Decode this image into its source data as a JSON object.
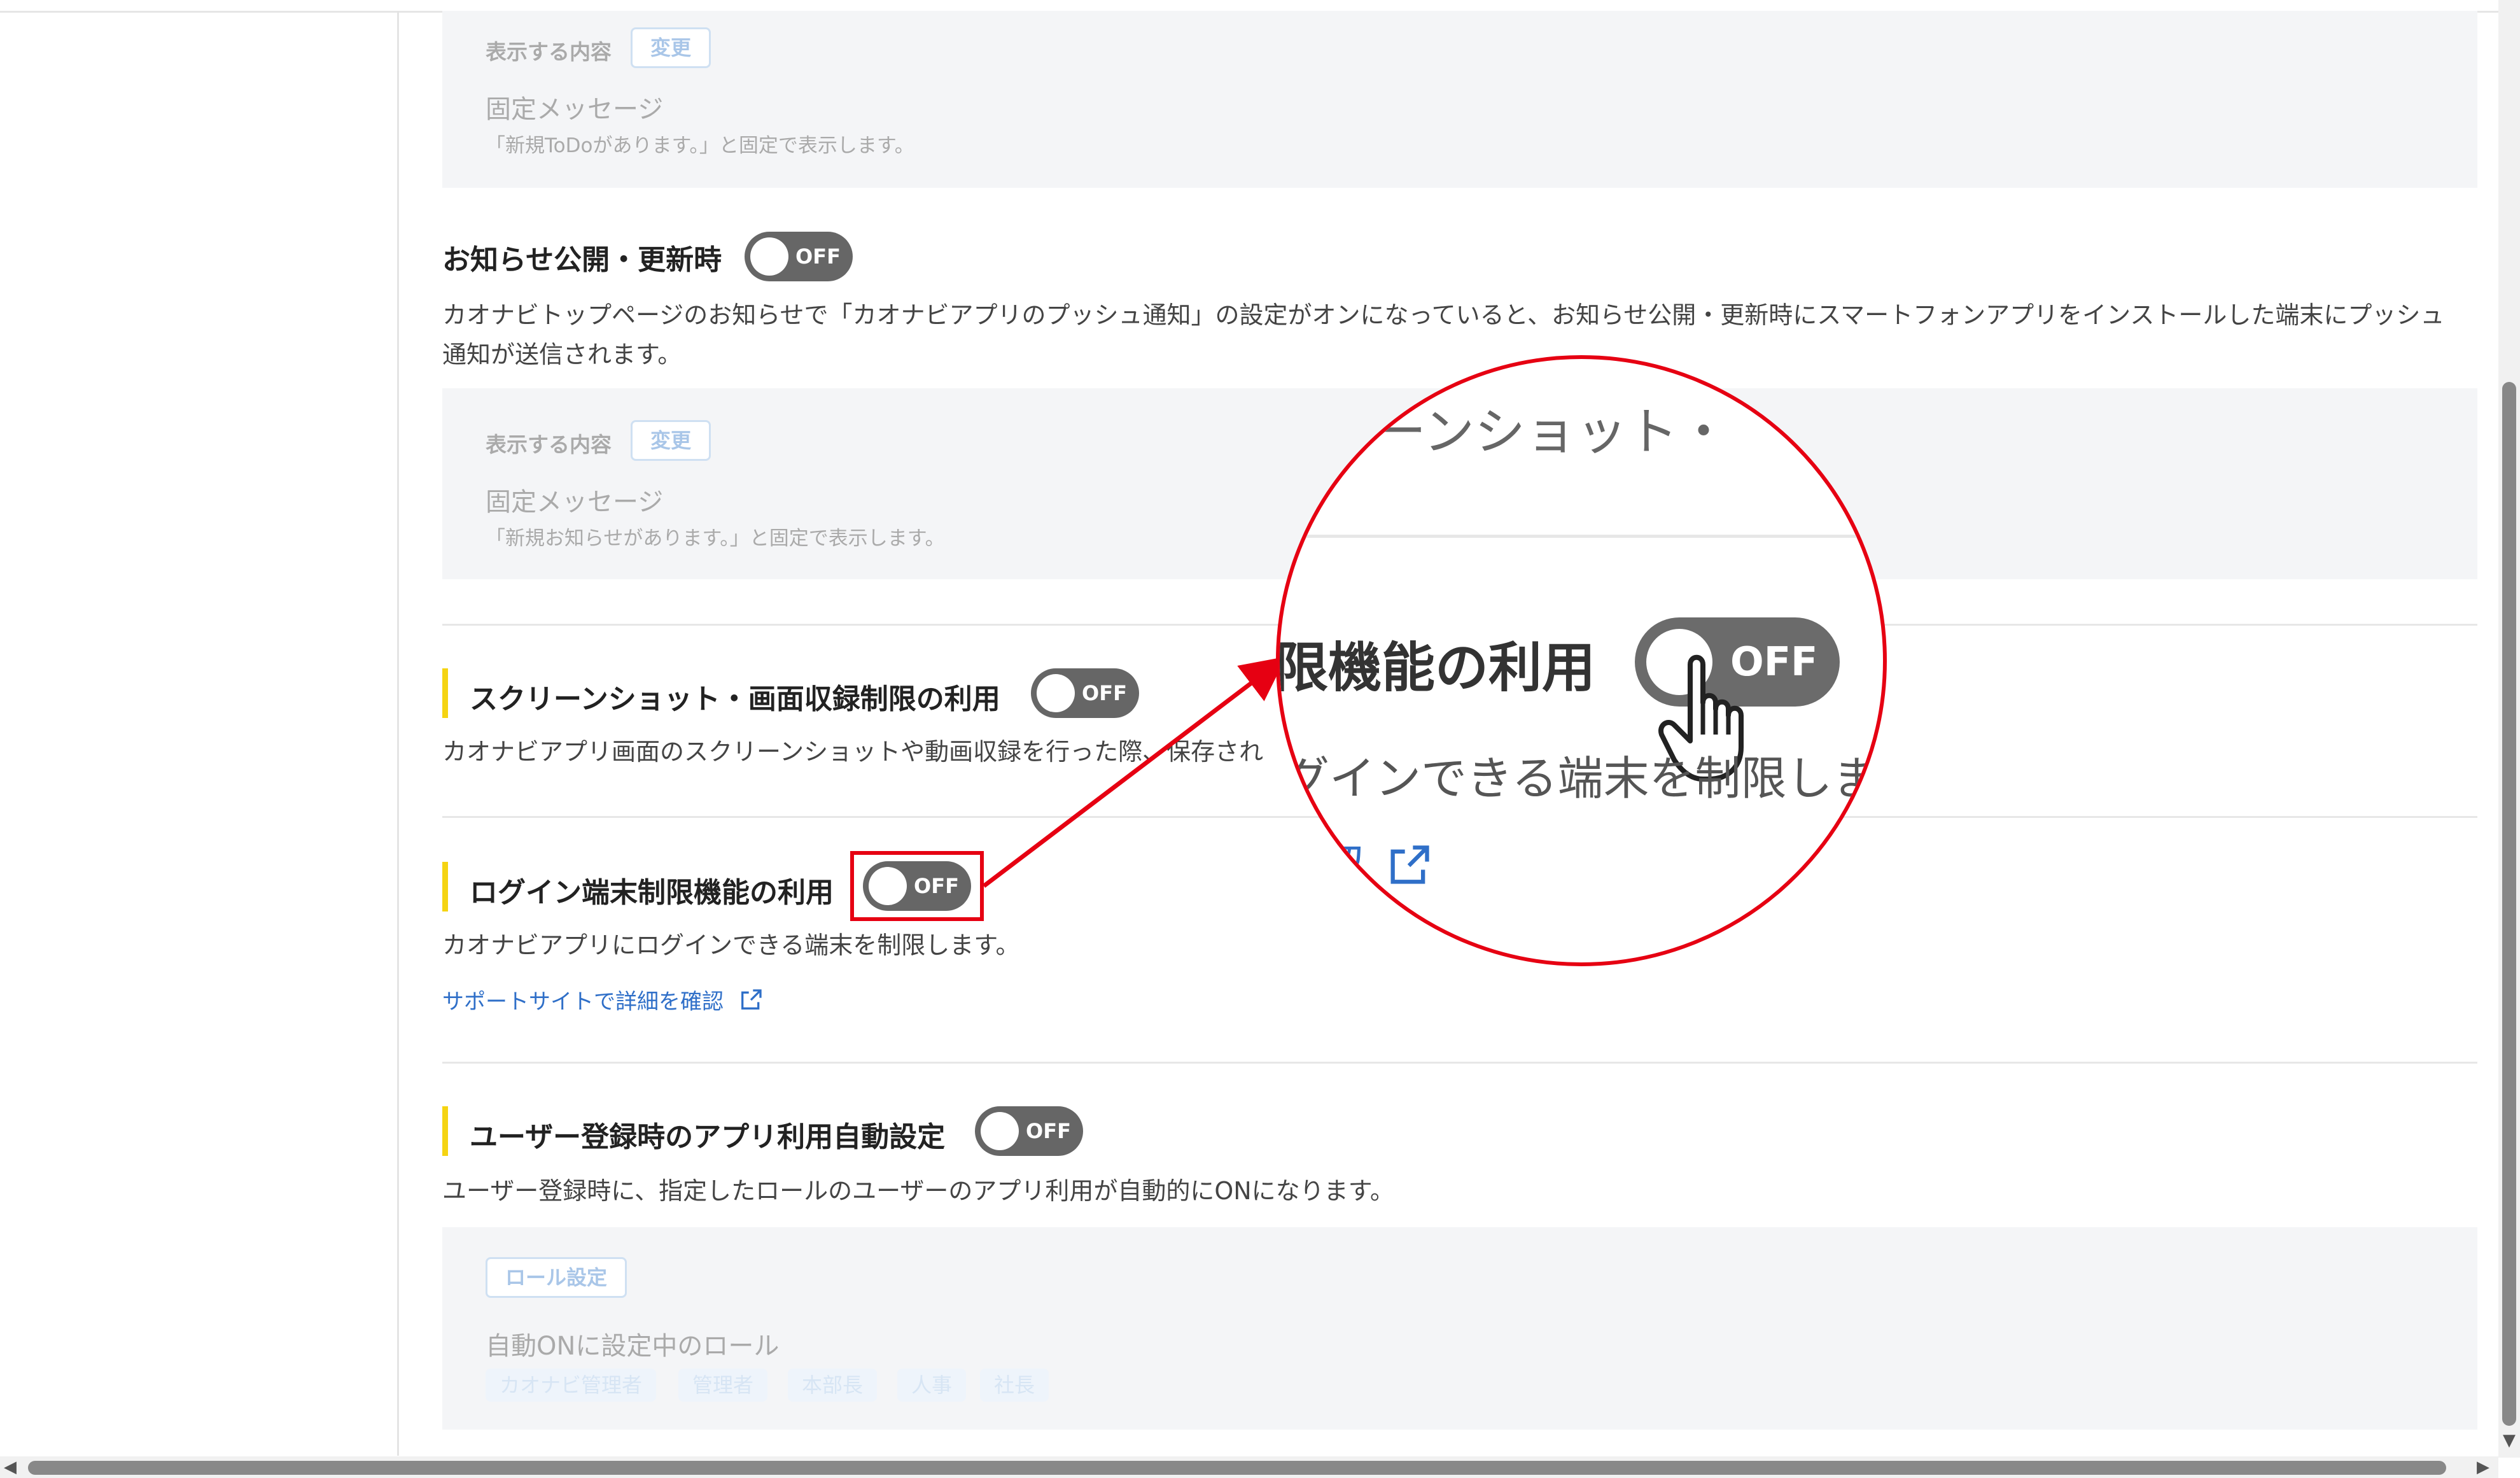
{
  "todo_section": {
    "display_label": "表示する内容",
    "change_button": "変更",
    "message_title": "固定メッセージ",
    "message_sub": "「新規ToDoがあります。」と固定で表示します。"
  },
  "notice_section": {
    "title": "お知らせ公開・更新時",
    "toggle": "OFF",
    "description": "カオナビトップページのお知らせで「カオナビアプリのプッシュ通知」の設定がオンになっていると、お知らせ公開・更新時にスマートフォンアプリをインストールした端末にプッシュ通知が送信されます。",
    "display_label": "表示する内容",
    "change_button": "変更",
    "message_title": "固定メッセージ",
    "message_sub": "「新規お知らせがあります。」と固定で表示します。"
  },
  "screenshot_section": {
    "title": "スクリーンショット・画面収録制限の利用",
    "toggle": "OFF",
    "description": "カオナビアプリ画面のスクリーンショットや動画収録を行った際、保存され"
  },
  "login_section": {
    "title": "ログイン端末制限機能の利用",
    "toggle": "OFF",
    "description": "カオナビアプリにログインできる端末を制限します。",
    "support_link": "サポートサイトで詳細を確認"
  },
  "user_section": {
    "title": "ユーザー登録時のアプリ利用自動設定",
    "toggle": "OFF",
    "description": "ユーザー登録時に、指定したロールのユーザーのアプリ利用が自動的にONになります。",
    "role_button": "ロール設定",
    "roles_title": "自動ONに設定中のロール",
    "roles": [
      "カオナビ管理者",
      "管理者",
      "本部長",
      "人事",
      "社長"
    ]
  },
  "zoom_callout": {
    "top_text": "クリーンショット・",
    "title_text": "限機能の利用",
    "toggle": "OFF",
    "desc_text": "グインできる端末を制限しま",
    "link_text": "認"
  },
  "colors": {
    "accent_yellow": "#f5d412",
    "toggle_off": "#666666",
    "callout_red": "#e60012",
    "link_blue": "#2f6fc8"
  }
}
